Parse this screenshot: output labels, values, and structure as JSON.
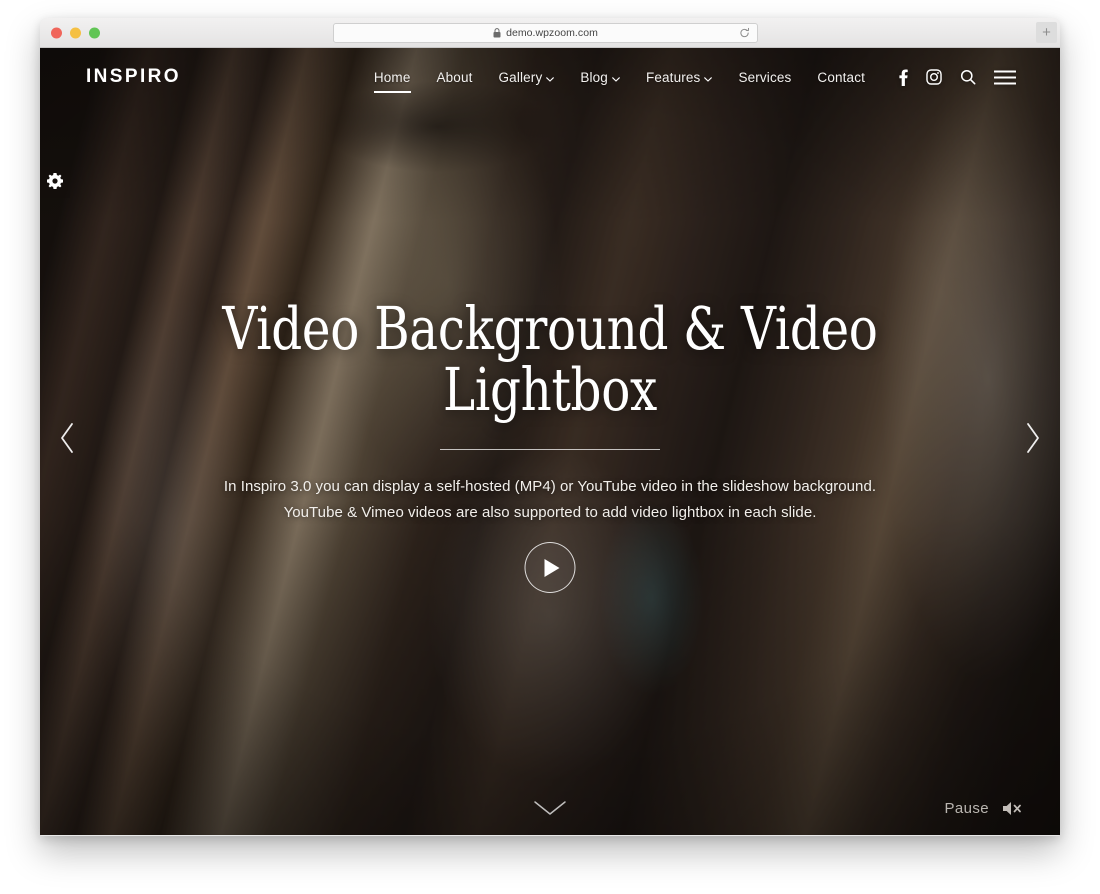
{
  "browser": {
    "url": "demo.wpzoom.com",
    "lock_icon": "lock-icon",
    "reload_icon": "reload-icon",
    "new_tab_label": "+",
    "traffic_lights": [
      "close",
      "minimize",
      "maximize"
    ]
  },
  "site": {
    "logo": "INSPIRO",
    "nav": [
      {
        "label": "Home",
        "active": true,
        "has_dropdown": false
      },
      {
        "label": "About",
        "active": false,
        "has_dropdown": false
      },
      {
        "label": "Gallery",
        "active": false,
        "has_dropdown": true
      },
      {
        "label": "Blog",
        "active": false,
        "has_dropdown": true
      },
      {
        "label": "Features",
        "active": false,
        "has_dropdown": true
      },
      {
        "label": "Services",
        "active": false,
        "has_dropdown": false
      },
      {
        "label": "Contact",
        "active": false,
        "has_dropdown": false
      }
    ],
    "nav_icons": [
      "facebook-icon",
      "instagram-icon",
      "search-icon",
      "hamburger-menu-icon"
    ],
    "settings_icon": "gear-icon"
  },
  "slide": {
    "title": "Video Background & Video Lightbox",
    "description_line1": "In Inspiro 3.0 you can display a self-hosted (MP4) or YouTube video in the slideshow background.",
    "description_line2": "YouTube & Vimeo videos are also supported to add video lightbox in each slide.",
    "play_icon": "play-icon",
    "prev_icon": "chevron-left-icon",
    "next_icon": "chevron-right-icon",
    "scroll_down_icon": "chevron-down-icon"
  },
  "media_controls": {
    "pause_label": "Pause",
    "mute_icon": "speaker-muted-icon"
  },
  "colors": {
    "accent_white": "#ffffff",
    "pause_text": "#b9b5b0",
    "chrome_bg": "#eeeded"
  }
}
